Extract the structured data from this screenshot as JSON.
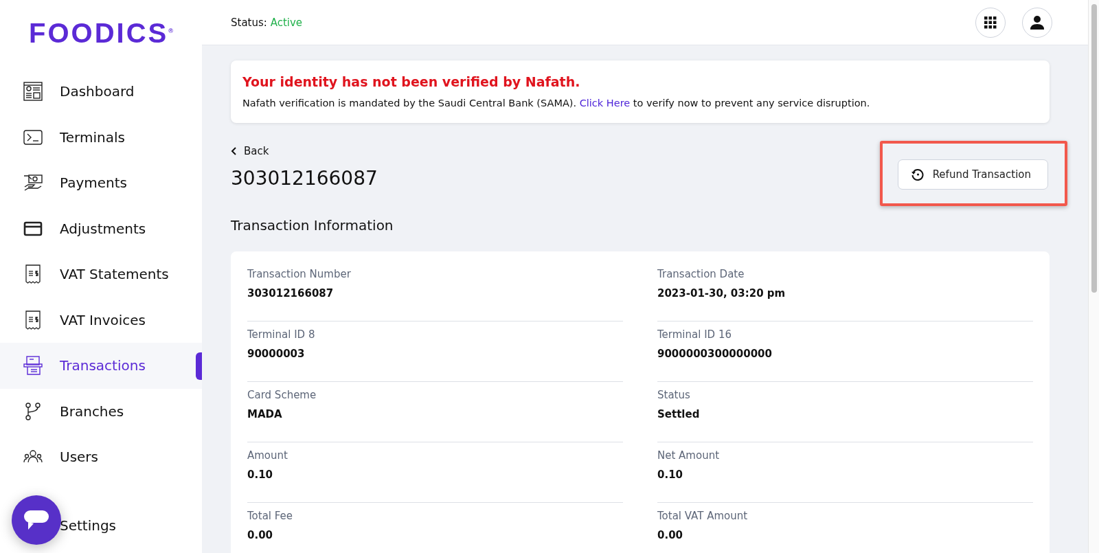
{
  "logo": {
    "text": "FOODICS",
    "mark": "®"
  },
  "sidebar": {
    "items": [
      {
        "label": "Dashboard",
        "selected": false
      },
      {
        "label": "Terminals",
        "selected": false
      },
      {
        "label": "Payments",
        "selected": false
      },
      {
        "label": "Adjustments",
        "selected": false
      },
      {
        "label": "VAT Statements",
        "selected": false
      },
      {
        "label": "VAT Invoices",
        "selected": false
      },
      {
        "label": "Transactions",
        "selected": true
      },
      {
        "label": "Branches",
        "selected": false
      },
      {
        "label": "Users",
        "selected": false
      },
      {
        "label": "Settings",
        "selected": false
      }
    ]
  },
  "header": {
    "status_label": "Status:",
    "status_value": "Active"
  },
  "alert": {
    "title": "Your identity has not been verified by Nafath.",
    "text_before": "Nafath verification is mandated by the Saudi Central Bank (SAMA).",
    "link": "Click Here",
    "text_after": "to verify now to prevent any service disruption."
  },
  "back": {
    "label": "Back"
  },
  "page_title": "303012166087",
  "refund_button": {
    "label": "Refund Transaction",
    "highlighted": true
  },
  "section_title": "Transaction Information",
  "fields": [
    {
      "label": "Transaction Number",
      "value": "303012166087"
    },
    {
      "label": "Transaction Date",
      "value": "2023-01-30, 03:20 pm"
    },
    {
      "label": "Terminal ID 8",
      "value": "90000003"
    },
    {
      "label": "Terminal ID 16",
      "value": "9000000300000000"
    },
    {
      "label": "Card Scheme",
      "value": "MADA"
    },
    {
      "label": "Status",
      "value": "Settled"
    },
    {
      "label": "Amount",
      "value": "0.10"
    },
    {
      "label": "Net Amount",
      "value": "0.10"
    },
    {
      "label": "Total Fee",
      "value": "0.00"
    },
    {
      "label": "Total VAT Amount",
      "value": "0.00"
    }
  ]
}
